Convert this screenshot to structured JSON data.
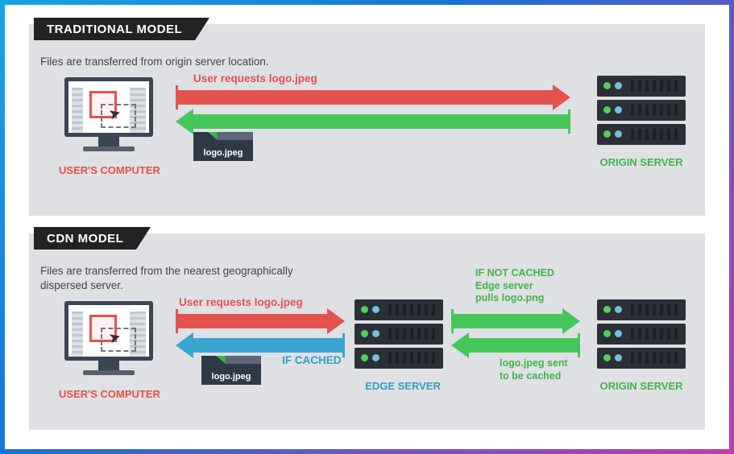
{
  "traditional": {
    "tab": "TRADITIONAL MODEL",
    "desc": "Files are transferred from origin server location.",
    "request_label": "User requests logo.jpeg",
    "file_label": "logo.jpeg",
    "user_label": "USER'S COMPUTER",
    "origin_label": "ORIGIN SERVER"
  },
  "cdn": {
    "tab": "CDN MODEL",
    "desc": "Files are transferred from the nearest geographically dispersed server.",
    "request_label": "User requests logo.jpeg",
    "cached_label": "IF CACHED",
    "file_label": "logo.jpeg",
    "user_label": "USER'S COMPUTER",
    "edge_label": "EDGE SERVER",
    "origin_label": "ORIGIN SERVER",
    "not_cached_note": "IF NOT CACHED\nEdge server\npulls logo.png",
    "sent_note": "logo.jpeg sent\nto be cached"
  }
}
